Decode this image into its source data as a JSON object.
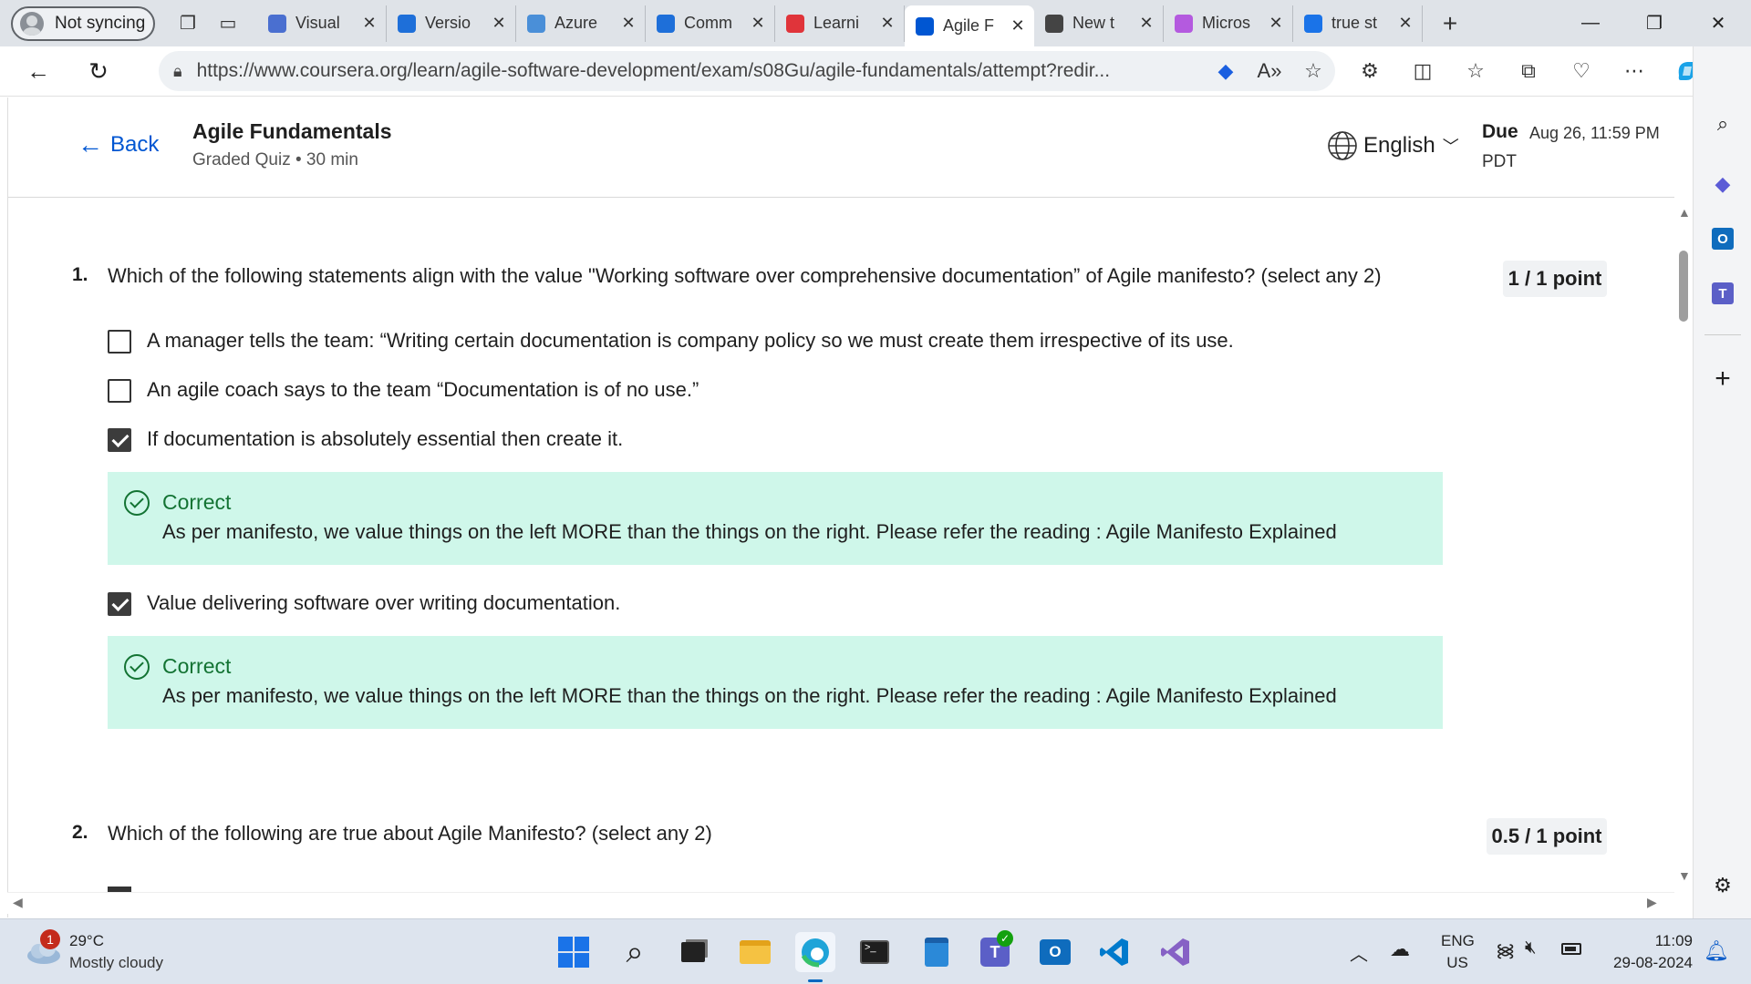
{
  "browser": {
    "profile_label": "Not syncing",
    "tabs": [
      {
        "label": "Visual",
        "color": "#4a6fd0"
      },
      {
        "label": "Versio",
        "color": "#1e6fd9"
      },
      {
        "label": "Azure",
        "color": "#4a8fd8"
      },
      {
        "label": "Comm",
        "color": "#1e6fd9"
      },
      {
        "label": "Learni",
        "color": "#e0343a"
      },
      {
        "label": "Agile F",
        "color": "#0056d2",
        "active": true
      },
      {
        "label": "New t",
        "color": "#444444"
      },
      {
        "label": "Micros",
        "color": "#b45adf"
      },
      {
        "label": "true st",
        "color": "#1a73e8"
      }
    ],
    "url": "https://www.coursera.org/learn/agile-software-development/exam/s08Gu/agile-fundamentals/attempt?redir..."
  },
  "header": {
    "back_label": "Back",
    "title": "Agile Fundamentals",
    "subtitle": "Graded Quiz • 30 min",
    "language": "English",
    "due_label": "Due",
    "due_date": "Aug 26, 11:59 PM",
    "due_tz": "PDT"
  },
  "questions": [
    {
      "number": "1.",
      "text": "Which of the following statements align with the value \"Working software over comprehensive documentation” of Agile manifesto? (select any 2)",
      "points": "1 / 1 point",
      "options": [
        {
          "text": "A manager tells the team: “Writing certain documentation is company policy so we must create them irrespective of its use.",
          "checked": false
        },
        {
          "text": "An agile coach says to the team “Documentation is of no use.”",
          "checked": false
        },
        {
          "text": "If documentation is absolutely essential then create it.",
          "checked": true
        },
        {
          "text": "Value delivering software over writing documentation.",
          "checked": true
        }
      ],
      "feedback": [
        {
          "title": "Correct",
          "text": "As per manifesto, we value things on the left MORE than the things on the right. Please refer the reading : Agile Manifesto Explained"
        },
        {
          "title": "Correct",
          "text": "As per manifesto, we value things on the left MORE than the things on the right. Please refer the reading : Agile Manifesto Explained"
        }
      ]
    },
    {
      "number": "2.",
      "text": "Which of the following are true about Agile Manifesto? (select any 2)",
      "points": "0.5 / 1 point"
    }
  ],
  "taskbar": {
    "weather_temp": "29°C",
    "weather_desc": "Mostly cloudy",
    "weather_badge": "1",
    "lang_top": "ENG",
    "lang_bottom": "US",
    "time": "11:09",
    "date": "29-08-2024"
  }
}
